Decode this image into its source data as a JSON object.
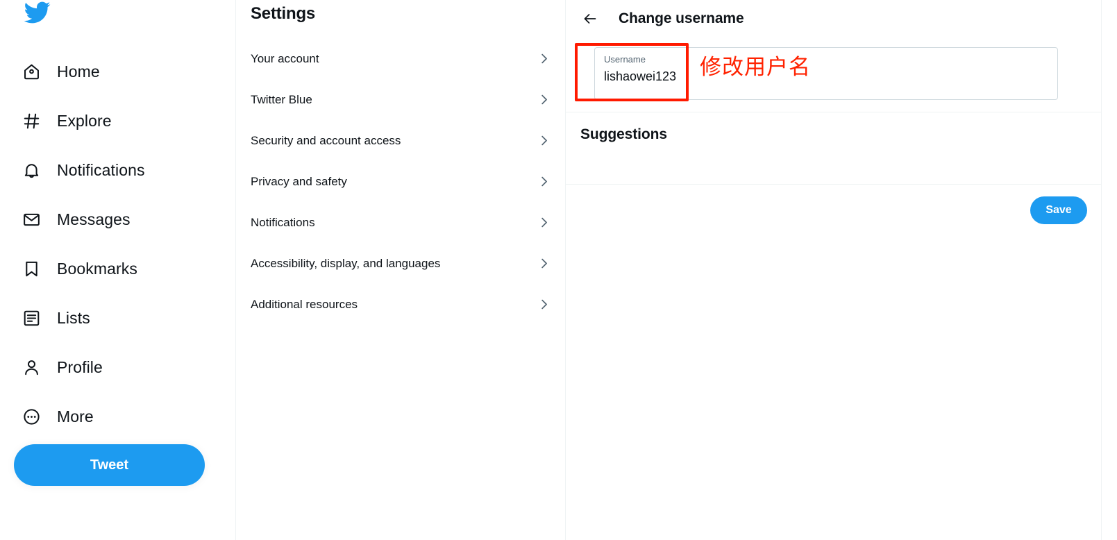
{
  "brand": {
    "logo_icon": "twitter-bird-icon",
    "accent_color": "#1d9bf0",
    "text_color": "#0f1419",
    "muted_color": "#536471",
    "border_color": "#eff3f4",
    "annotation_color": "#ff2200"
  },
  "sidebar": {
    "items": [
      {
        "label": "Home",
        "icon": "home-icon"
      },
      {
        "label": "Explore",
        "icon": "hashtag-icon"
      },
      {
        "label": "Notifications",
        "icon": "bell-icon"
      },
      {
        "label": "Messages",
        "icon": "envelope-icon"
      },
      {
        "label": "Bookmarks",
        "icon": "bookmark-icon"
      },
      {
        "label": "Lists",
        "icon": "list-icon"
      },
      {
        "label": "Profile",
        "icon": "person-icon"
      },
      {
        "label": "More",
        "icon": "more-circle-icon"
      }
    ],
    "tweet_button": "Tweet"
  },
  "settings": {
    "title": "Settings",
    "items": [
      {
        "label": "Your account",
        "chevron": "chevron-right-icon"
      },
      {
        "label": "Twitter Blue",
        "chevron": "chevron-right-icon"
      },
      {
        "label": "Security and account access",
        "chevron": "chevron-right-icon"
      },
      {
        "label": "Privacy and safety",
        "chevron": "chevron-right-icon"
      },
      {
        "label": "Notifications",
        "chevron": "chevron-right-icon"
      },
      {
        "label": "Accessibility, display, and languages",
        "chevron": "chevron-right-icon"
      },
      {
        "label": "Additional resources",
        "chevron": "chevron-right-icon"
      }
    ]
  },
  "main": {
    "back_icon": "back-arrow-icon",
    "title": "Change username",
    "username_field": {
      "label": "Username",
      "value": "lishaowei123"
    },
    "suggestions_title": "Suggestions",
    "save_label": "Save"
  },
  "annotations": {
    "highlight_box": "red-rectangle-highlight",
    "note_text": "修改用户名"
  }
}
